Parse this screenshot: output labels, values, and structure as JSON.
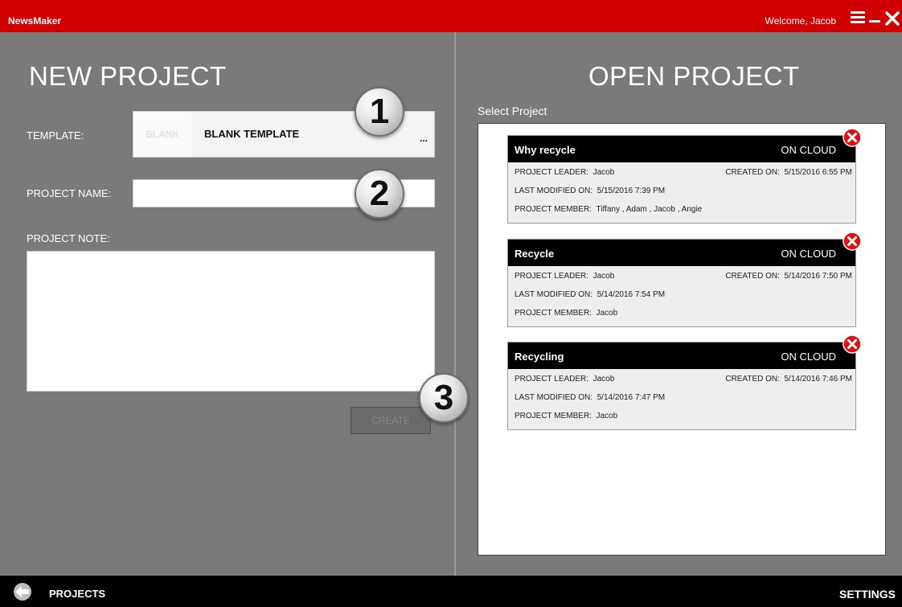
{
  "titlebar": {
    "app_name": "NewsMaker",
    "welcome": "Welcome, Jacob"
  },
  "new_project": {
    "title": "NEW PROJECT",
    "template_label": "TEMPLATE:",
    "template_thumb": "BLANK",
    "template_name": "BLANK TEMPLATE",
    "template_more": "...",
    "name_label": "PROJECT NAME:",
    "name_value": "",
    "note_label": "PROJECT NOTE:",
    "note_value": "",
    "create_label": "CREATE"
  },
  "badges": [
    "1",
    "2",
    "3"
  ],
  "open_project": {
    "title": "OPEN PROJECT",
    "select_label": "Select Project",
    "projects": [
      {
        "name": "Why recycle",
        "status": "ON CLOUD",
        "leader_key": "PROJECT LEADER:",
        "leader": "Jacob",
        "created_key": "CREATED ON:",
        "created": "5/15/2016 6:55 PM",
        "modified_key": "LAST MODIFIED ON:",
        "modified": "5/15/2016 7:39 PM",
        "members_key": "PROJECT MEMBER:",
        "members": "Tiffany , Adam , Jacob , Angie"
      },
      {
        "name": "Recycle",
        "status": "ON CLOUD",
        "leader_key": "PROJECT LEADER:",
        "leader": "Jacob",
        "created_key": "CREATED ON:",
        "created": "5/14/2016 7:50 PM",
        "modified_key": "LAST MODIFIED ON:",
        "modified": "5/14/2016 7:54 PM",
        "members_key": "PROJECT MEMBER:",
        "members": "Jacob"
      },
      {
        "name": "Recycling",
        "status": "ON CLOUD",
        "leader_key": "PROJECT LEADER:",
        "leader": "Jacob",
        "created_key": "CREATED ON:",
        "created": "5/14/2016 7:46 PM",
        "modified_key": "LAST MODIFIED ON:",
        "modified": "5/14/2016 7:47 PM",
        "members_key": "PROJECT MEMBER:",
        "members": "Jacob"
      }
    ]
  },
  "bottombar": {
    "projects_label": "PROJECTS",
    "settings_label": "SETTINGS"
  },
  "icons": {
    "menu": "hamburger-menu-icon",
    "minimize": "minimize-icon",
    "close": "close-icon",
    "delete": "delete-circle-icon",
    "back": "back-arrow-icon"
  },
  "colors": {
    "titlebar": "#d10000",
    "panel": "#7a7a7a",
    "delete_red": "#e01010"
  }
}
